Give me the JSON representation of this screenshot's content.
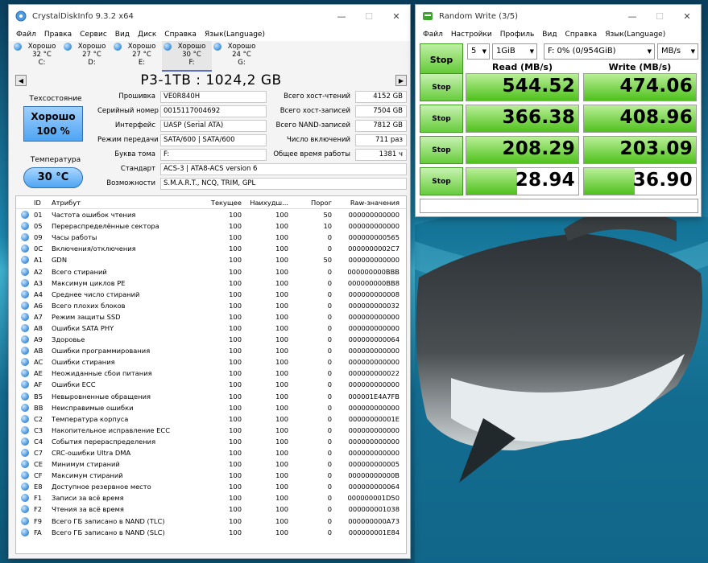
{
  "cdi": {
    "title": "CrystalDiskInfo 9.3.2 x64",
    "menu": [
      "Файл",
      "Правка",
      "Сервис",
      "Вид",
      "Диск",
      "Справка",
      "Язык(Language)"
    ],
    "disks": [
      {
        "status": "Хорошо",
        "temp": "32 °C",
        "letter": "C:"
      },
      {
        "status": "Хорошо",
        "temp": "27 °C",
        "letter": "D:"
      },
      {
        "status": "Хорошо",
        "temp": "27 °C",
        "letter": "E:"
      },
      {
        "status": "Хорошо",
        "temp": "30 °C",
        "letter": "F:"
      },
      {
        "status": "Хорошо",
        "temp": "24 °C",
        "letter": "G:"
      }
    ],
    "model": "P3-1TB : 1024,2 GB",
    "health_label": "Техсостояние",
    "health_status": "Хорошо",
    "health_percent": "100 %",
    "temp_label": "Температура",
    "temp_value": "30 °C",
    "info": {
      "firmware_label": "Прошивка",
      "firmware": "VE0R840H",
      "serial_label": "Серийный номер",
      "serial": "0015117004692",
      "interface_label": "Интерфейс",
      "interface": "UASP (Serial ATA)",
      "transfer_label": "Режим передачи",
      "transfer": "SATA/600 | SATA/600",
      "volume_label": "Буква тома",
      "volume": "F:",
      "standard_label": "Стандарт",
      "standard": "ACS-3 | ATA8-ACS version 6",
      "features_label": "Возможности",
      "features": "S.M.A.R.T., NCQ, TRIM, GPL",
      "host_reads_label": "Всего хост-чтений",
      "host_reads": "4152 GB",
      "host_writes_label": "Всего хост-записей",
      "host_writes": "7504 GB",
      "nand_writes_label": "Всего NAND-записей",
      "nand_writes": "7812 GB",
      "power_count_label": "Число включений",
      "power_count": "711 раз",
      "power_hours_label": "Общее время работы",
      "power_hours": "1381 ч"
    },
    "table_headers": {
      "id": "ID",
      "name": "Атрибут",
      "current": "Текущее",
      "worst": "Наихудш...",
      "threshold": "Порог",
      "raw": "Raw-значения"
    },
    "attributes": [
      {
        "id": "01",
        "name": "Частота ошибок чтения",
        "cur": "100",
        "worst": "100",
        "thr": "50",
        "raw": "000000000000"
      },
      {
        "id": "05",
        "name": "Перераспределённые сектора",
        "cur": "100",
        "worst": "100",
        "thr": "10",
        "raw": "000000000000"
      },
      {
        "id": "09",
        "name": "Часы работы",
        "cur": "100",
        "worst": "100",
        "thr": "0",
        "raw": "000000000565"
      },
      {
        "id": "0C",
        "name": "Включения/отключения",
        "cur": "100",
        "worst": "100",
        "thr": "0",
        "raw": "0000000002C7"
      },
      {
        "id": "A1",
        "name": "GDN",
        "cur": "100",
        "worst": "100",
        "thr": "50",
        "raw": "000000000000"
      },
      {
        "id": "A2",
        "name": "Всего стираний",
        "cur": "100",
        "worst": "100",
        "thr": "0",
        "raw": "000000000BBB"
      },
      {
        "id": "A3",
        "name": "Максимум циклов PE",
        "cur": "100",
        "worst": "100",
        "thr": "0",
        "raw": "000000000BB8"
      },
      {
        "id": "A4",
        "name": "Среднее число стираний",
        "cur": "100",
        "worst": "100",
        "thr": "0",
        "raw": "000000000008"
      },
      {
        "id": "A6",
        "name": "Всего плохих блоков",
        "cur": "100",
        "worst": "100",
        "thr": "0",
        "raw": "000000000032"
      },
      {
        "id": "A7",
        "name": "Режим защиты SSD",
        "cur": "100",
        "worst": "100",
        "thr": "0",
        "raw": "000000000000"
      },
      {
        "id": "A8",
        "name": "Ошибки SATA PHY",
        "cur": "100",
        "worst": "100",
        "thr": "0",
        "raw": "000000000000"
      },
      {
        "id": "A9",
        "name": "Здоровье",
        "cur": "100",
        "worst": "100",
        "thr": "0",
        "raw": "000000000064"
      },
      {
        "id": "AB",
        "name": "Ошибки программирования",
        "cur": "100",
        "worst": "100",
        "thr": "0",
        "raw": "000000000000"
      },
      {
        "id": "AC",
        "name": "Ошибки стирания",
        "cur": "100",
        "worst": "100",
        "thr": "0",
        "raw": "000000000000"
      },
      {
        "id": "AE",
        "name": "Неожиданные сбои питания",
        "cur": "100",
        "worst": "100",
        "thr": "0",
        "raw": "000000000022"
      },
      {
        "id": "AF",
        "name": "Ошибки ECC",
        "cur": "100",
        "worst": "100",
        "thr": "0",
        "raw": "000000000000"
      },
      {
        "id": "B5",
        "name": "Невыровненные обращения",
        "cur": "100",
        "worst": "100",
        "thr": "0",
        "raw": "000001E4A7FB"
      },
      {
        "id": "BB",
        "name": "Неисправимые ошибки",
        "cur": "100",
        "worst": "100",
        "thr": "0",
        "raw": "000000000000"
      },
      {
        "id": "C2",
        "name": "Температура корпуса",
        "cur": "100",
        "worst": "100",
        "thr": "0",
        "raw": "00000000001E"
      },
      {
        "id": "C3",
        "name": "Накопительное исправление ECC",
        "cur": "100",
        "worst": "100",
        "thr": "0",
        "raw": "000000000000"
      },
      {
        "id": "C4",
        "name": "События перераспределения",
        "cur": "100",
        "worst": "100",
        "thr": "0",
        "raw": "000000000000"
      },
      {
        "id": "C7",
        "name": "CRC-ошибки Ultra DMA",
        "cur": "100",
        "worst": "100",
        "thr": "0",
        "raw": "000000000000"
      },
      {
        "id": "CE",
        "name": "Минимум стираний",
        "cur": "100",
        "worst": "100",
        "thr": "0",
        "raw": "000000000005"
      },
      {
        "id": "CF",
        "name": "Максимум стираний",
        "cur": "100",
        "worst": "100",
        "thr": "0",
        "raw": "00000000000B"
      },
      {
        "id": "E8",
        "name": "Доступное резервное место",
        "cur": "100",
        "worst": "100",
        "thr": "0",
        "raw": "000000000064"
      },
      {
        "id": "F1",
        "name": "Записи за всё время",
        "cur": "100",
        "worst": "100",
        "thr": "0",
        "raw": "000000001D50"
      },
      {
        "id": "F2",
        "name": "Чтения за всё время",
        "cur": "100",
        "worst": "100",
        "thr": "0",
        "raw": "000000001038"
      },
      {
        "id": "F9",
        "name": "Всего ГБ записано в NAND (TLC)",
        "cur": "100",
        "worst": "100",
        "thr": "0",
        "raw": "000000000A73"
      },
      {
        "id": "FA",
        "name": "Всего ГБ записано в NAND (SLC)",
        "cur": "100",
        "worst": "100",
        "thr": "0",
        "raw": "000000001E84"
      }
    ]
  },
  "cdm": {
    "title": "Random Write (3/5)",
    "menu": [
      "Файл",
      "Настройки",
      "Профиль",
      "Вид",
      "Справка",
      "Язык(Language)"
    ],
    "stop_label": "Stop",
    "count": "5",
    "size": "1GiB",
    "drive": "F: 0% (0/954GiB)",
    "unit": "MB/s",
    "read_header": "Read (MB/s)",
    "write_header": "Write (MB/s)",
    "rows": [
      {
        "stop": "Stop",
        "read": "544.52",
        "write": "474.06",
        "read_fill": 1.0,
        "write_fill": 1.0
      },
      {
        "stop": "Stop",
        "read": "366.38",
        "write": "408.96",
        "read_fill": 1.0,
        "write_fill": 1.0
      },
      {
        "stop": "Stop",
        "read": "208.29",
        "write": "203.09",
        "read_fill": 1.0,
        "write_fill": 1.0
      },
      {
        "stop": "Stop",
        "read": "28.94",
        "write": "36.90",
        "read_fill": 0.45,
        "write_fill": 0.45
      }
    ]
  }
}
